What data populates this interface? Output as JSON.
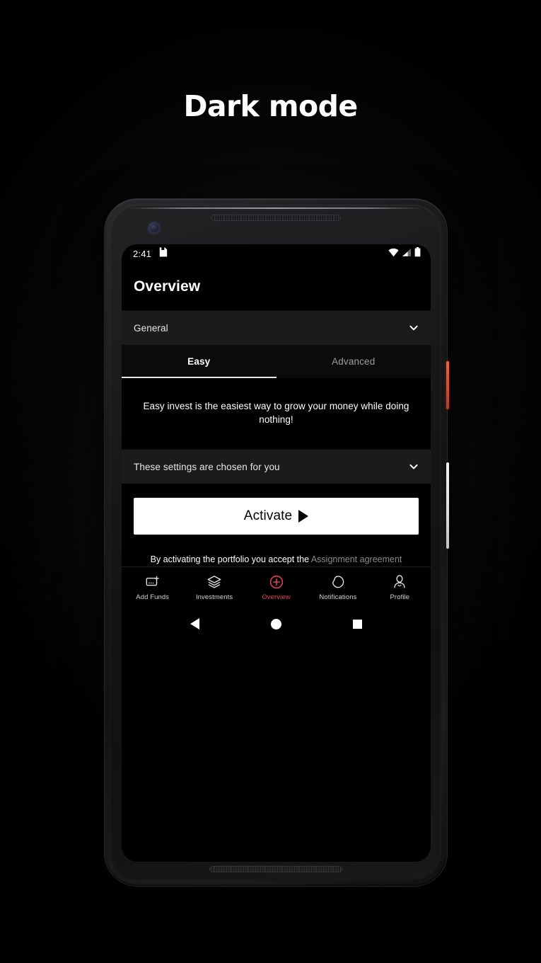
{
  "heading": "Dark mode",
  "device": {
    "power_button": "power-button",
    "volume_button": "volume-rocker"
  },
  "screen": {
    "status_bar": {
      "time": "2:41",
      "left_icons": [
        "save-icon"
      ],
      "right_icons": [
        "wifi-icon",
        "cellular-signal-icon",
        "battery-icon"
      ]
    },
    "app_bar": {
      "title": "Overview"
    },
    "section_selector": {
      "label": "General",
      "chevron": "chevron-down-icon"
    },
    "tabs": [
      {
        "label": "Easy",
        "active": true
      },
      {
        "label": "Advanced",
        "active": false
      }
    ],
    "description": "Easy invest is the easiest way to grow your money while doing nothing!",
    "settings_row": {
      "label": "These settings are chosen for you",
      "chevron": "chevron-down-icon"
    },
    "cta": {
      "activate_label": "Activate",
      "play_icon": "play-icon"
    },
    "disclaimer": {
      "prefix": "By activating the portfolio you accept the ",
      "link": "Assignment agreement"
    },
    "bottom_nav": [
      {
        "label": "Add Funds",
        "icon": "add-funds-icon",
        "active": false
      },
      {
        "label": "Investments",
        "icon": "layers-icon",
        "active": false
      },
      {
        "label": "Overview",
        "icon": "plus-circle-icon",
        "active": true
      },
      {
        "label": "Notifications",
        "icon": "bell-icon",
        "active": false
      },
      {
        "label": "Profile",
        "icon": "person-icon",
        "active": false
      }
    ],
    "system_nav": [
      "back-button",
      "home-button",
      "recents-button"
    ]
  },
  "colors": {
    "background": "#000000",
    "accent": "#e04257",
    "surface": "#1b1b1b",
    "tab_bar": "#0b0b0b",
    "power_button": "#e04f33",
    "text_primary": "#ffffff",
    "text_secondary": "#8a8a8a"
  }
}
